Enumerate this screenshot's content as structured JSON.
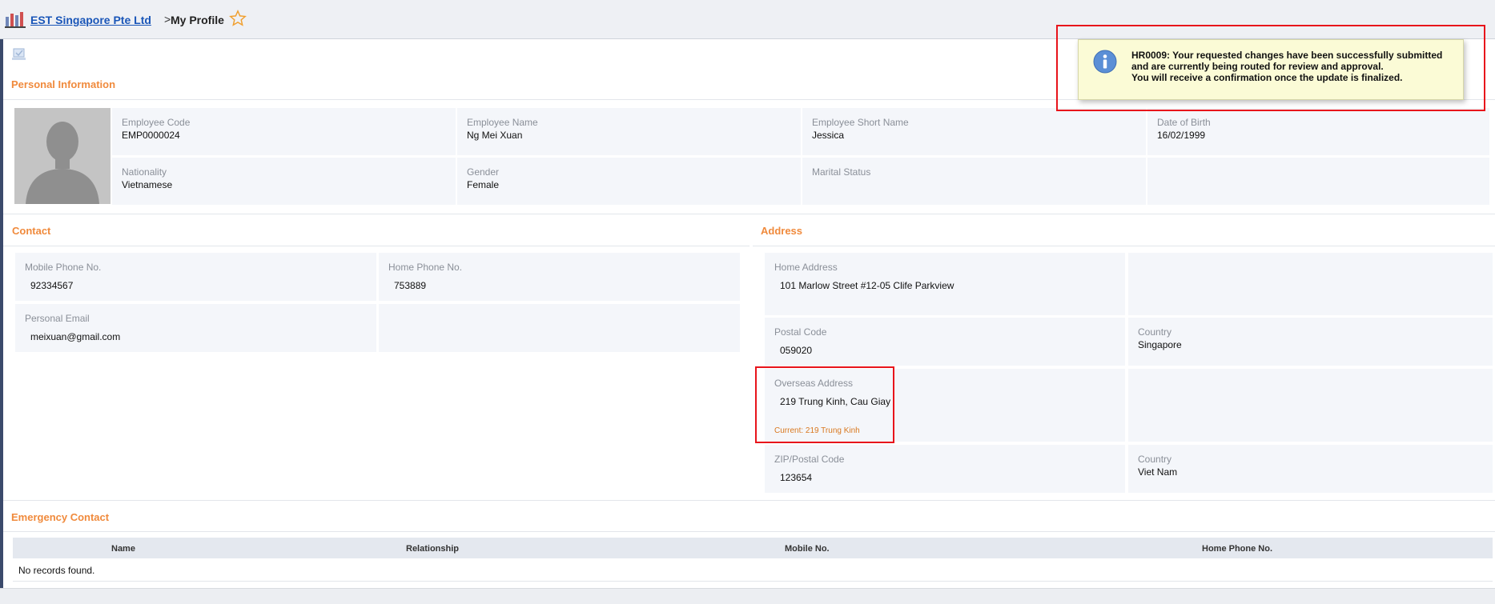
{
  "header": {
    "company": "EST Singapore Pte Ltd",
    "separator": ">",
    "page_title": "My Profile"
  },
  "notification": {
    "line1": "HR0009: Your requested changes have been successfully submitted",
    "line2": "and are currently being routed for review and approval.",
    "line3": "You will receive a confirmation once the update is finalized."
  },
  "personal": {
    "title": "Personal Information",
    "employee_code_label": "Employee Code",
    "employee_code": "EMP0000024",
    "employee_name_label": "Employee Name",
    "employee_name": "Ng Mei Xuan",
    "short_name_label": "Employee Short Name",
    "short_name": "Jessica",
    "dob_label": "Date of Birth",
    "dob": "16/02/1999",
    "nationality_label": "Nationality",
    "nationality": "Vietnamese",
    "gender_label": "Gender",
    "gender": "Female",
    "marital_label": "Marital Status",
    "marital": ""
  },
  "contact": {
    "title": "Contact",
    "mobile_label": "Mobile Phone No.",
    "mobile": "92334567",
    "home_label": "Home Phone No.",
    "home": "753889",
    "email_label": "Personal Email",
    "email": "meixuan@gmail.com"
  },
  "address": {
    "title": "Address",
    "home_address_label": "Home Address",
    "home_address": "101 Marlow Street #12-05 Clife Parkview",
    "postal_label": "Postal Code",
    "postal": "059020",
    "country_label": "Country",
    "country": "Singapore",
    "overseas_label": "Overseas Address",
    "overseas": "219 Trung Kinh, Cau Giay",
    "overseas_current": "Current: 219 Trung Kinh",
    "zip_label": "ZIP/Postal Code",
    "zip": "123654",
    "overseas_country_label": "Country",
    "overseas_country": "Viet Nam"
  },
  "emergency": {
    "title": "Emergency Contact",
    "columns": [
      "Name",
      "Relationship",
      "Mobile No.",
      "Home Phone No."
    ],
    "empty_text": "No records found."
  },
  "colors": {
    "accent": "#f08a3c",
    "link": "#1a56b8",
    "highlight": "#e8141b",
    "notify_bg": "#fbfbd6"
  },
  "icons": [
    "company-logo-icon",
    "star-icon",
    "info-icon",
    "checkbox-icon",
    "avatar-placeholder"
  ]
}
